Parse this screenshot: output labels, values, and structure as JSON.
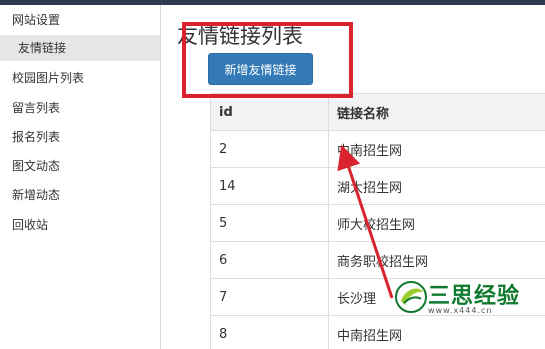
{
  "sidebar": {
    "items": [
      {
        "label": "网站设置"
      },
      {
        "label": "友情链接",
        "active": true
      },
      {
        "label": "校园图片列表"
      },
      {
        "label": "留言列表"
      },
      {
        "label": "报名列表"
      },
      {
        "label": "图文动态"
      },
      {
        "label": "新增动态"
      },
      {
        "label": "回收站"
      }
    ]
  },
  "main": {
    "title": "友情链接列表",
    "add_button": "新增友情链接",
    "table": {
      "headers": [
        "id",
        "链接名称"
      ],
      "rows": [
        [
          "2",
          "中南招生网"
        ],
        [
          "14",
          "湖大招生网"
        ],
        [
          "5",
          "师大校招生网"
        ],
        [
          "6",
          "商务职校招生网"
        ],
        [
          "7",
          "长沙理"
        ],
        [
          "8",
          "中南招生网"
        ]
      ]
    }
  },
  "watermark": {
    "text": "三思经验",
    "url": "www.x444.cn"
  },
  "colors": {
    "accent": "#337ab7",
    "annotation": "#d9232e",
    "watermark": "#0f7a2e"
  }
}
